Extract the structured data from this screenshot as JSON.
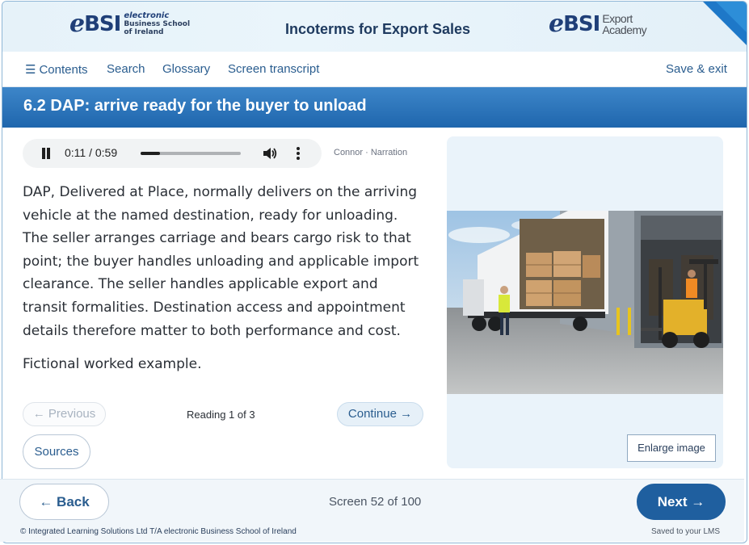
{
  "header": {
    "course_title": "Incoterms for Export Sales",
    "logo_left": {
      "e": "e",
      "bsi": "BSI",
      "line1": "electronic",
      "line2": "Business School",
      "line3": "of Ireland"
    },
    "logo_right": {
      "e": "e",
      "bsi": "BSI",
      "line1": "Export",
      "line2": "Academy"
    }
  },
  "nav": {
    "contents": "Contents",
    "search": "Search",
    "glossary": "Glossary",
    "transcript": "Screen transcript",
    "save_exit": "Save & exit"
  },
  "page": {
    "title": "6.2 DAP: arrive ready for the buyer to unload"
  },
  "audio": {
    "time": "0:11 / 0:59",
    "progress": 0.19,
    "narration": "Connor · Narration"
  },
  "body": {
    "paragraph": "DAP, Delivered at Place, normally delivers on the arriving vehicle at the named destination, ready for unloading. The seller arranges carriage and bears cargo risk to that point; the buyer handles unloading and applicable import clearance. The seller handles applicable export and transit formalities. Destination access and appointment details therefore matter to both performance and cost.",
    "example": "Fictional worked example."
  },
  "reading": {
    "prev_label": "← Previous",
    "status": "Reading 1 of 3",
    "continue_label": "Continue →",
    "sources_label": "Sources"
  },
  "image": {
    "enlarge_label": "Enlarge image"
  },
  "footer": {
    "back_label": "← Back",
    "screen_count": "Screen 52 of 100",
    "next_label": "Next →",
    "copyright": "© Integrated Learning Solutions Ltd T/A electronic Business School of Ireland",
    "saved": "Saved to your LMS"
  },
  "colors": {
    "accent": "#1e78c8",
    "title_bar": "#1f66ad",
    "next_button": "#1f5f9f",
    "link": "#2a5d8f"
  }
}
